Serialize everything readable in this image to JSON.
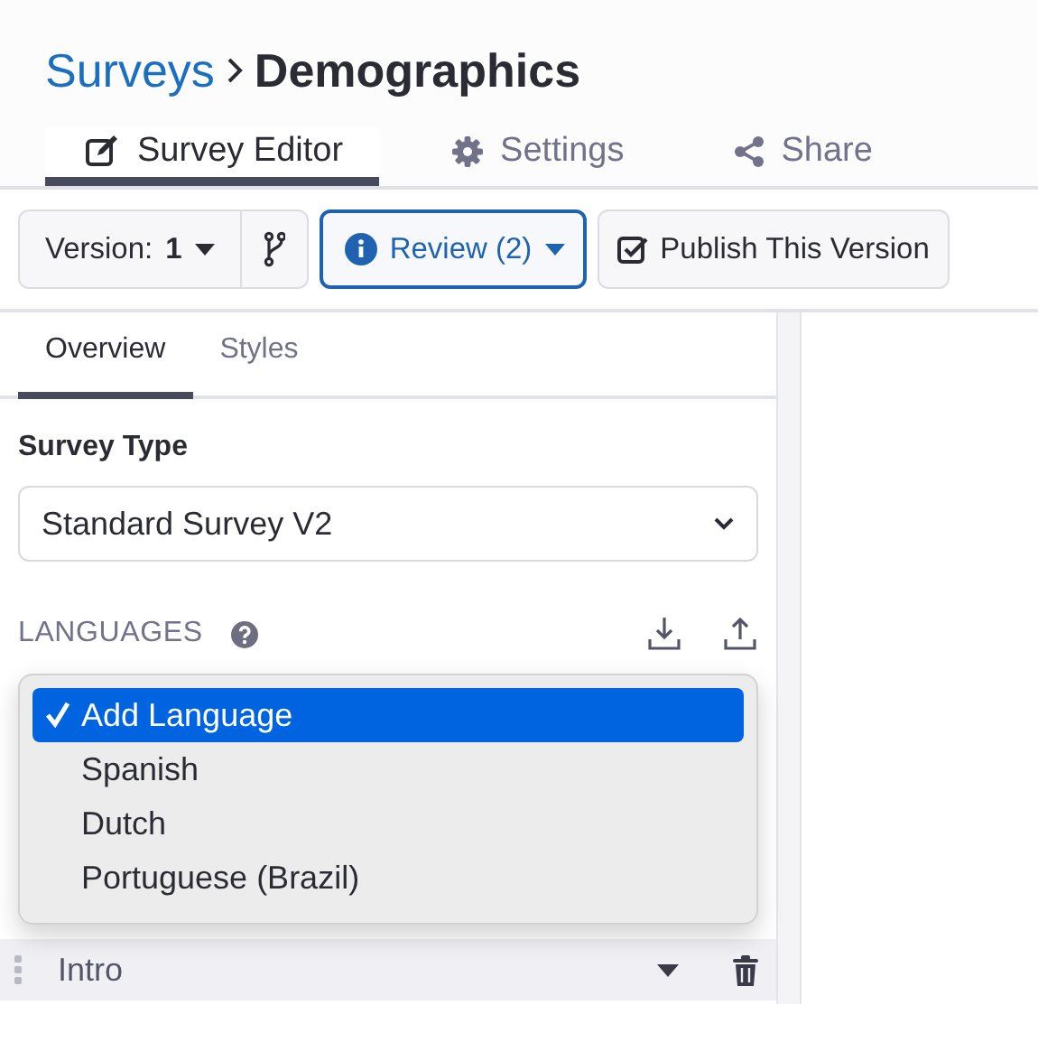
{
  "breadcrumb": {
    "parent": "Surveys",
    "current": "Demographics"
  },
  "tabs": [
    {
      "label": "Survey Editor",
      "selected": true
    },
    {
      "label": "Settings",
      "selected": false
    },
    {
      "label": "Share",
      "selected": false
    }
  ],
  "toolbar": {
    "version_label": "Version:",
    "version": "1",
    "review": "Review (2)",
    "publish": "Publish This Version"
  },
  "panel_tabs": [
    {
      "label": "Overview",
      "selected": true
    },
    {
      "label": "Styles",
      "selected": false
    }
  ],
  "survey_type": {
    "label": "Survey Type",
    "value": "Standard Survey V2"
  },
  "languages": {
    "heading": "LANGUAGES"
  },
  "language_menu": [
    {
      "label": "Add Language",
      "selected": true
    },
    {
      "label": "Spanish",
      "selected": false
    },
    {
      "label": "Dutch",
      "selected": false
    },
    {
      "label": "Portuguese (Brazil)",
      "selected": false
    }
  ],
  "sections": [
    {
      "label": "Intro"
    }
  ]
}
